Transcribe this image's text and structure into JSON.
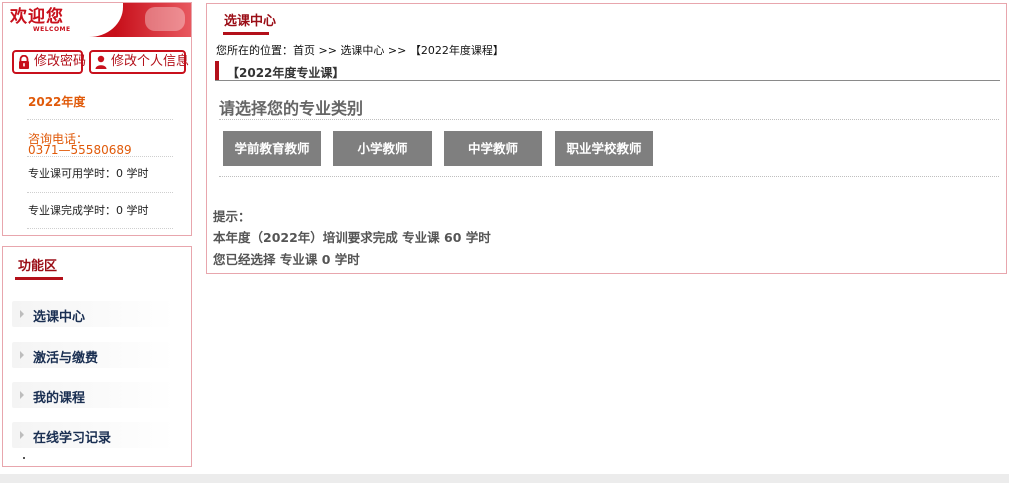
{
  "welcome": {
    "title": "欢迎您",
    "subtitle": "WELCOME"
  },
  "account_buttons": {
    "change_password": "修改密码",
    "edit_profile": "修改个人信息"
  },
  "user_info": {
    "year": "2022年度",
    "phone_label": "咨询电话：",
    "phone_number": "0371—55580689",
    "available_hours": "专业课可用学时：0 学时",
    "completed_hours": "专业课完成学时：0 学时"
  },
  "sidebar": {
    "title": "功能区",
    "items": [
      {
        "label": "选课中心"
      },
      {
        "label": "激活与缴费"
      },
      {
        "label": "我的课程"
      },
      {
        "label": "在线学习记录"
      }
    ]
  },
  "main": {
    "tab": "选课中心",
    "breadcrumb": {
      "prefix": "您所在的位置：",
      "home": "首页",
      "sep": " >> ",
      "center": "选课中心",
      "current": "【2022年度课程】"
    },
    "section_title": "【2022年度专业课】",
    "choose_title": "请选择您的专业类别",
    "categories": [
      {
        "label": "学前教育教师"
      },
      {
        "label": "小学教师"
      },
      {
        "label": "中学教师"
      },
      {
        "label": "职业学校教师"
      }
    ],
    "tips": {
      "heading": "提示：",
      "line1": "本年度（2022年）培训要求完成 专业课 60 学时",
      "line2": "您已经选择 专业课 0 学时"
    }
  },
  "colors": {
    "brand_red": "#c8101c",
    "panel_border": "#e8a6ad",
    "accent_orange": "#e05a0a",
    "category_button": "#7f7f7f",
    "menu_text": "#1a2f52"
  },
  "icons": {
    "change_password": "lock-icon",
    "edit_profile": "user-icon",
    "menu_item": "caret-right-icon"
  }
}
